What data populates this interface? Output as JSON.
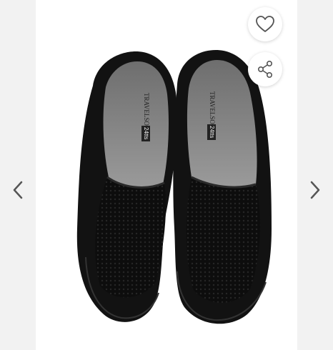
{
  "gallery": {
    "brand_print": "TRAVELSOFT",
    "size_print": "24tts",
    "colors": {
      "sideband": "#f2f2f2",
      "stage": "#ffffff",
      "shoe_black": "#111111",
      "lining_gray": "#8a8a8a",
      "icon_gray": "#555555"
    }
  },
  "icons": {
    "prev": "chevron-left-icon",
    "next": "chevron-right-icon",
    "favorite": "heart-outline-icon",
    "share": "share-icon"
  }
}
